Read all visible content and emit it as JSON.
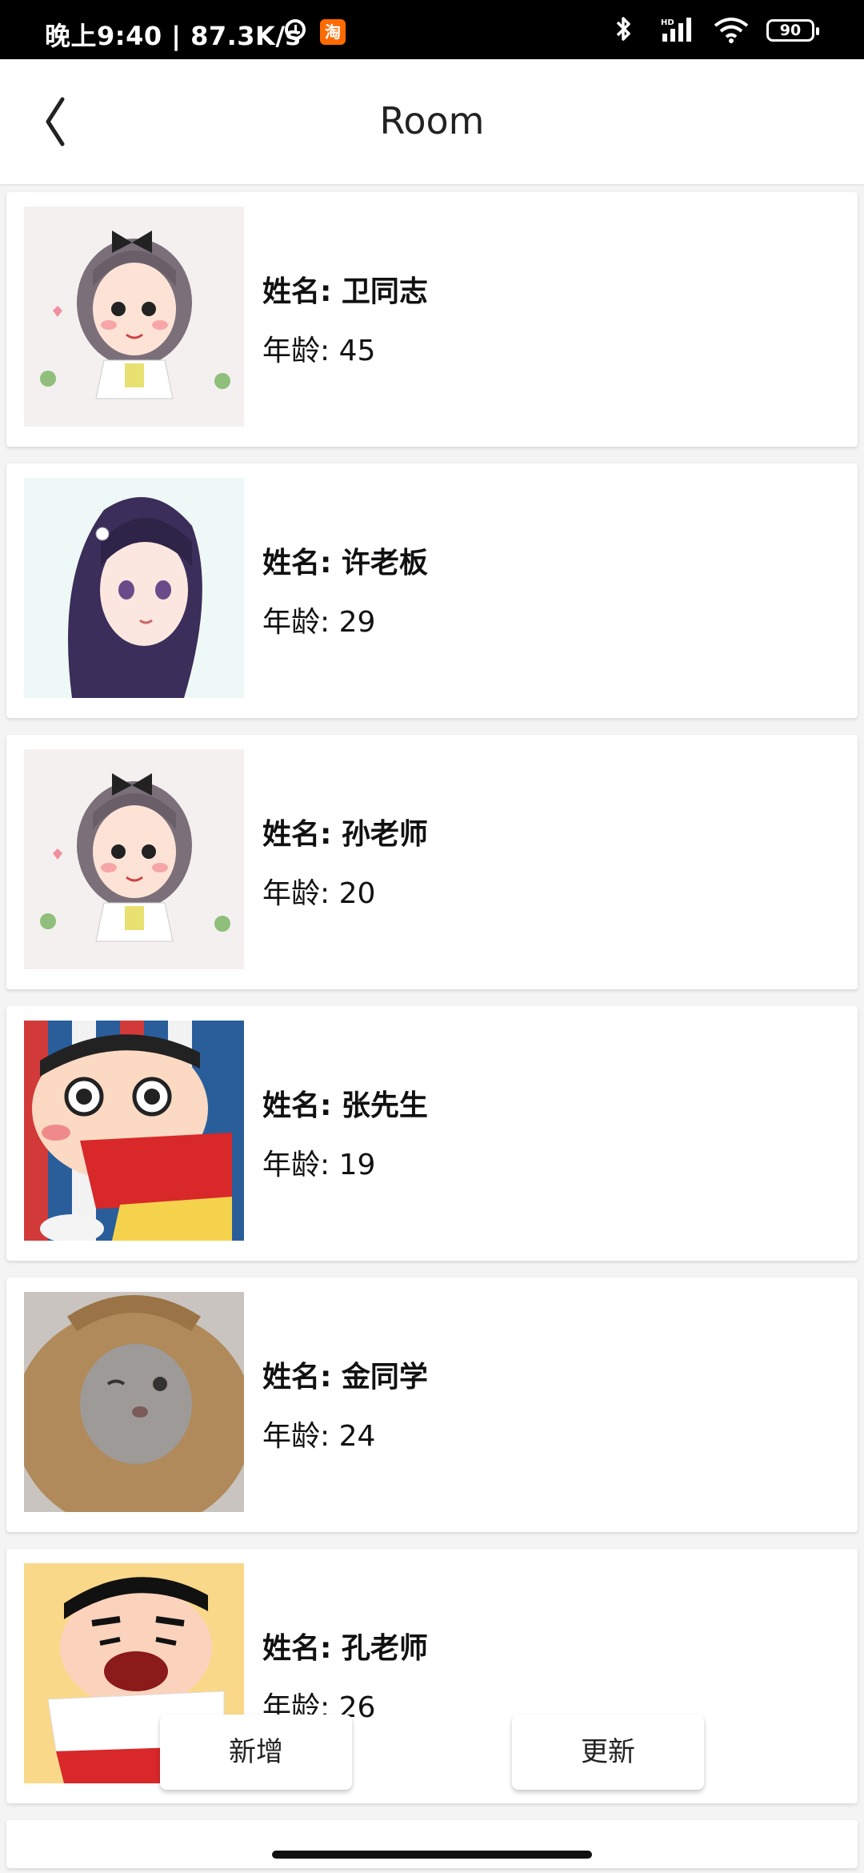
{
  "status_bar": {
    "time": "晚上9:40 | 87.3K/s",
    "taobao_icon": "淘",
    "battery": "90",
    "icons": [
      "alarm-icon",
      "taobao-icon",
      "bluetooth-icon",
      "signal-icon",
      "wifi-icon",
      "battery-icon"
    ]
  },
  "app_bar": {
    "title": "Room",
    "back_icon": "chevron-left-icon"
  },
  "list": {
    "items": [
      {
        "name_line": "姓名: 卫同志",
        "age_line": "年龄: 45",
        "avatar": "girl-with-bow"
      },
      {
        "name_line": "姓名: 许老板",
        "age_line": "年龄: 29",
        "avatar": "anime-girl"
      },
      {
        "name_line": "姓名: 孙老师",
        "age_line": "年龄: 20",
        "avatar": "girl-with-bow"
      },
      {
        "name_line": "姓名: 张先生",
        "age_line": "年龄: 19",
        "avatar": "crayon-shin-chan"
      },
      {
        "name_line": "姓名: 金同学",
        "age_line": "年龄: 24",
        "avatar": "cat-in-sweater"
      },
      {
        "name_line": "姓名: 孔老师",
        "age_line": "年龄: 26",
        "avatar": "crayon-shin-chan-dancing"
      }
    ]
  },
  "actions": {
    "add_label": "新增",
    "update_label": "更新"
  },
  "colors": {
    "status_bar_bg": "#000000",
    "app_bg": "#f4f4f4",
    "card_bg": "#ffffff",
    "taobao": "#ff6a00"
  }
}
